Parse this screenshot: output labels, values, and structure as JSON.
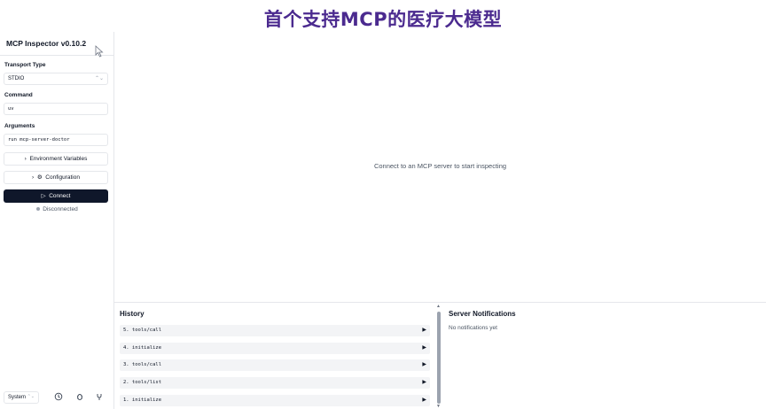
{
  "banner": {
    "title": "首个支持MCP的医疗大模型"
  },
  "sidebar": {
    "title": "MCP Inspector v0.10.2",
    "transport": {
      "label": "Transport Type",
      "value": "STDIO"
    },
    "command": {
      "label": "Command",
      "value": "uv"
    },
    "arguments": {
      "label": "Arguments",
      "value": "run mcp-server-doctor"
    },
    "env_button": "Environment Variables",
    "config_button": "Configuration",
    "connect_button": "Connect",
    "status": "Disconnected",
    "theme_select": "System"
  },
  "main": {
    "empty_message": "Connect to an MCP server to start inspecting"
  },
  "history": {
    "title": "History",
    "items": [
      {
        "label": "5. tools/call"
      },
      {
        "label": "4. initialize"
      },
      {
        "label": "3. tools/call"
      },
      {
        "label": "2. tools/list"
      },
      {
        "label": "1. initialize"
      }
    ]
  },
  "notifications": {
    "title": "Server Notifications",
    "empty": "No notifications yet"
  },
  "icons": {
    "expand": "chevron-right-icon",
    "config": "gear-icon",
    "play": "play-icon",
    "history_toggle": "triangle-right-icon"
  }
}
